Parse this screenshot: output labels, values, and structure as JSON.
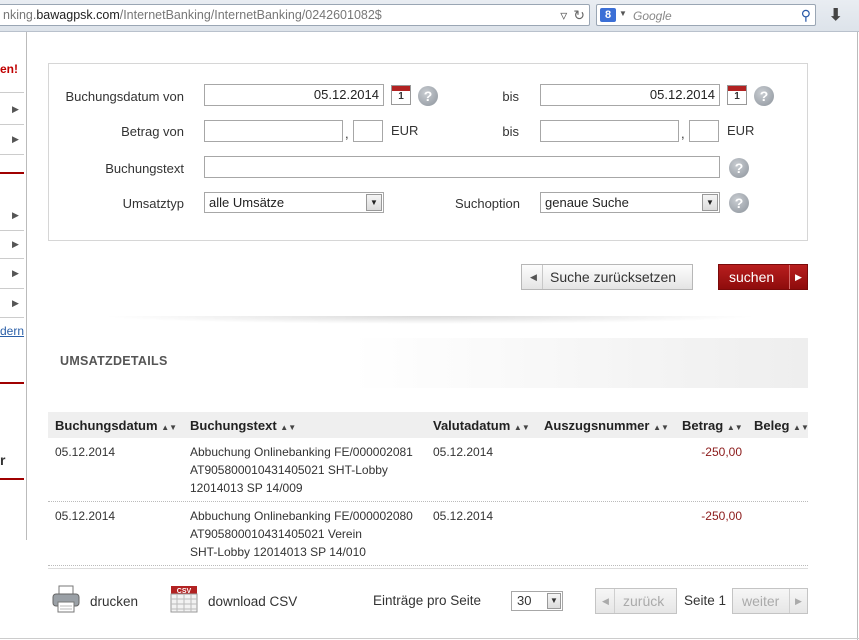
{
  "browser": {
    "url_prefix": "nking.",
    "url_domain": "bawagpsk.com",
    "url_path": "/InternetBanking/InternetBanking/0242601082$",
    "search_placeholder": "Google",
    "search_engine_letter": "8"
  },
  "sidebar": {
    "red_text": "en!",
    "link_text": "dern",
    "bold_text": "r"
  },
  "form": {
    "date_from_label": "Buchungsdatum von",
    "date_from_value": "05.12.2014",
    "date_to_label": "bis",
    "date_to_value": "05.12.2014",
    "calendar_day": "1",
    "amount_from_label": "Betrag von",
    "amount_to_label": "bis",
    "amount_from_value": "",
    "amount_from_cents": "",
    "amount_to_value": "",
    "amount_to_cents": "",
    "comma": ",",
    "currency": "EUR",
    "text_label": "Buchungstext",
    "text_value": "",
    "type_label": "Umsatztyp",
    "type_value": "alle Umsätze",
    "option_label": "Suchoption",
    "option_value": "genaue Suche",
    "help_glyph": "?"
  },
  "buttons": {
    "reset_label": "Suche zurücksetzen",
    "search_label": "suchen"
  },
  "section": {
    "title": "UMSATZDETAILS"
  },
  "table": {
    "sort_glyph": "▲▼",
    "headers": [
      "Buchungsdatum",
      "Buchungstext",
      "Valutadatum",
      "Auszugsnummer",
      "Betrag",
      "Beleg"
    ],
    "rows": [
      {
        "date": "05.12.2014",
        "text_lines": [
          "Abbuchung Onlinebanking FE/000002081",
          "AT905800010431405021 SHT-Lobby",
          "12014013 SP 14/009"
        ],
        "valuta": "05.12.2014",
        "statement": "",
        "amount": "-250,00"
      },
      {
        "date": "05.12.2014",
        "text_lines": [
          "Abbuchung Onlinebanking FE/000002080",
          "AT905800010431405021 Verein",
          "SHT-Lobby 12014013 SP 14/010"
        ],
        "valuta": "05.12.2014",
        "statement": "",
        "amount": "-250,00"
      }
    ]
  },
  "footer": {
    "print_label": "drucken",
    "csv_label": "download CSV",
    "csv_badge": "CSV",
    "per_page_label": "Einträge pro Seite",
    "per_page_value": "30",
    "prev_label": "zurück",
    "page_label": "Seite 1",
    "next_label": "weiter"
  }
}
